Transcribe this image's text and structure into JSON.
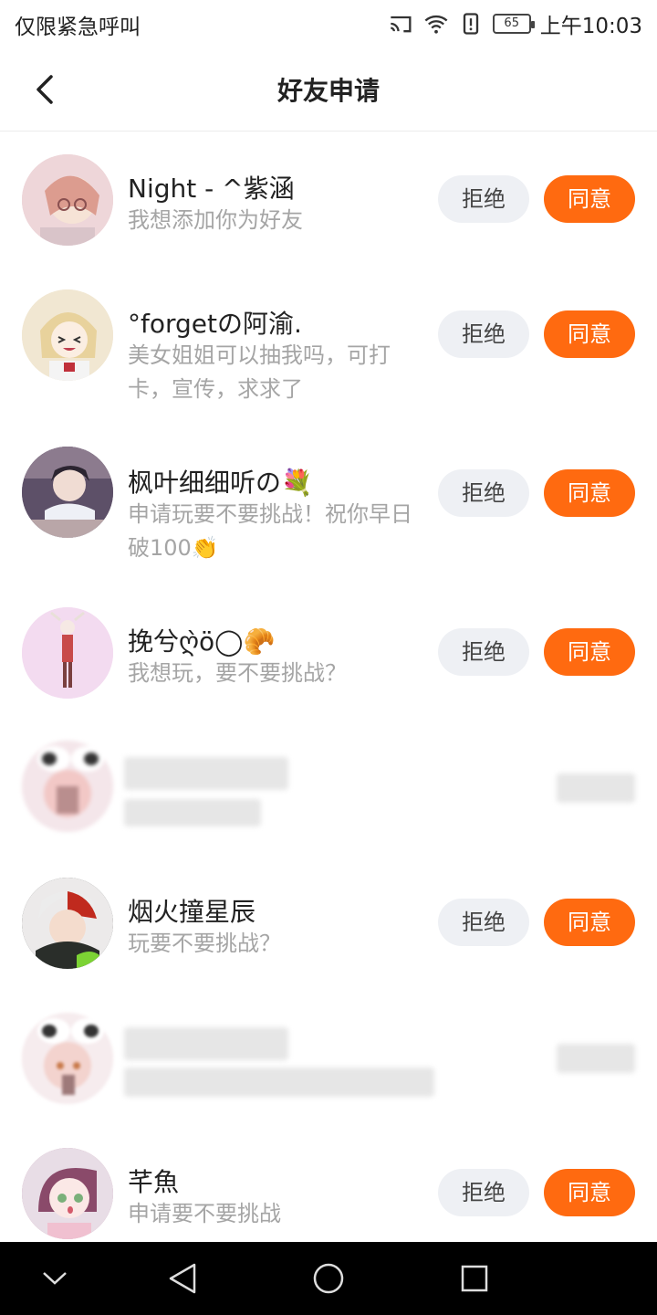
{
  "status_bar": {
    "carrier": "仅限紧急呼叫",
    "battery": "65",
    "time": "上午10:03"
  },
  "header": {
    "title": "好友申请"
  },
  "buttons": {
    "reject": "拒绝",
    "accept": "同意"
  },
  "requests": [
    {
      "name": "Night  -  ^紫涵",
      "message": "我想添加你为好友",
      "avatar_color": "#e9c9cf"
    },
    {
      "name": "°forgetの阿渝.",
      "message": "美女姐姐可以抽我吗，可打卡，宣传，求求了",
      "avatar_color": "#efe3cc"
    },
    {
      "name": "枫叶细细听の💐",
      "message": "申请玩要不要挑战！祝你早日破100👏",
      "avatar_color": "#6b5d74"
    },
    {
      "name": "挽兮ღ̀ö◯🥐",
      "message": "我想玩，要不要挑战？",
      "avatar_color": "#f2d7ef"
    },
    {
      "name": "",
      "message": "",
      "avatar_color": "#f0d0d8",
      "blurred": true
    },
    {
      "name": "烟火撞星辰",
      "message": "玩要不要挑战？",
      "avatar_color": "#3a3f3c"
    },
    {
      "name": "",
      "message": "",
      "avatar_color": "#f2d6da",
      "blurred": true
    },
    {
      "name": "芊魚",
      "message": "申请要不要挑战",
      "avatar_color": "#b7809e"
    }
  ]
}
